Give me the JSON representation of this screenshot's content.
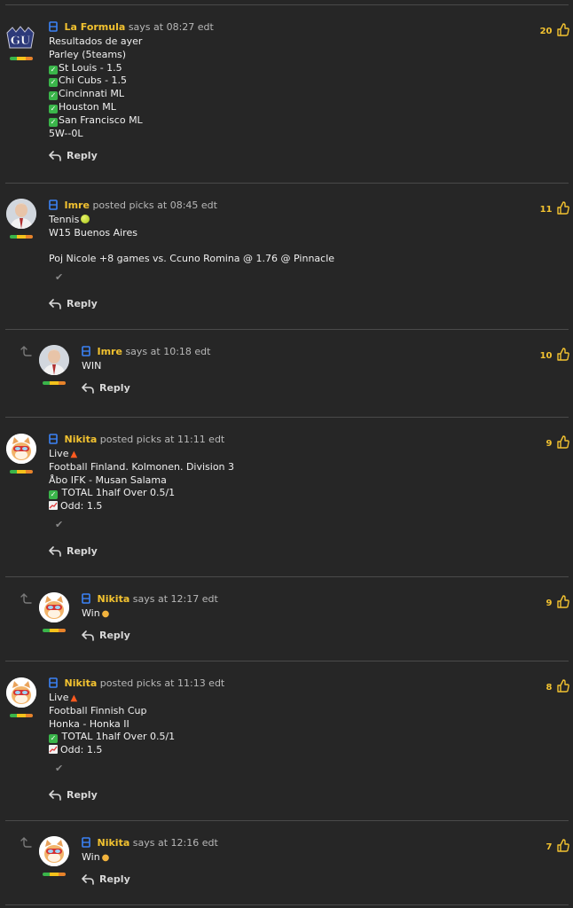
{
  "comments": [
    {
      "username": "La Formula",
      "action": "says at 08:27 edt",
      "likes": "20",
      "lines": [
        "Resultados de ayer",
        "Parley (5teams)",
        "St Louis - 1.5",
        "Chi Cubs - 1.5",
        "Cincinnati ML",
        "Houston ML",
        "San Francisco ML",
        "5W--0L"
      ],
      "reply_label": "Reply"
    },
    {
      "username": "Imre",
      "action": "posted picks at 08:45 edt",
      "likes": "11",
      "lines": [
        "Tennis",
        "W15 Buenos Aires",
        "",
        "Poj Nicole +8 games vs. Ccuno Romina @ 1.76 @ Pinnacle"
      ],
      "reply_label": "Reply"
    },
    {
      "username": "Imre",
      "action": "says at 10:18 edt",
      "likes": "10",
      "lines": [
        "WIN"
      ],
      "reply_label": "Reply"
    },
    {
      "username": "Nikita",
      "action": "posted picks at 11:11 edt",
      "likes": "9",
      "lines": [
        "Live",
        "Football Finland. Kolmonen. Division 3",
        "Åbo IFK - Musan Salama",
        "TOTAL 1half Over 0.5/1",
        "Odd: 1.5"
      ],
      "reply_label": "Reply"
    },
    {
      "username": "Nikita",
      "action": "says at 12:17 edt",
      "likes": "9",
      "lines": [
        "Win"
      ],
      "reply_label": "Reply"
    },
    {
      "username": "Nikita",
      "action": "posted picks at 11:13 edt",
      "likes": "8",
      "lines": [
        "Live",
        "Football Finnish Cup",
        "Honka - Honka II",
        "TOTAL 1half Over 0.5/1",
        "Odd: 1.5"
      ],
      "reply_label": "Reply"
    },
    {
      "username": "Nikita",
      "action": "says at 12:16 edt",
      "likes": "7",
      "lines": [
        "Win"
      ],
      "reply_label": "Reply"
    }
  ],
  "colors": {
    "background": "#262626",
    "username": "#f2c230",
    "divider": "#4a4a4a",
    "check": "#3ab54a"
  },
  "icons": {
    "ticket": "ticket-icon",
    "reply": "reply-arrow-icon",
    "like": "thumbs-up-icon",
    "nested": "nested-reply-icon",
    "checkmark": "checkmark-icon"
  }
}
